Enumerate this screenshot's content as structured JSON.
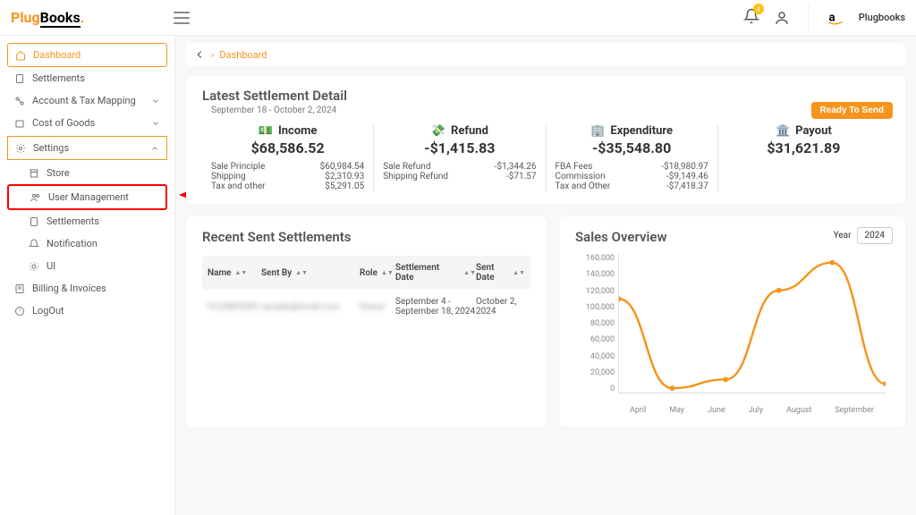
{
  "brand": {
    "plug": "Plug",
    "books": "Books"
  },
  "topbar": {
    "integration": "Plugbooks",
    "notif_count": "4"
  },
  "sidebar": {
    "dashboard": "Dashboard",
    "settlements": "Settlements",
    "account_tax": "Account & Tax Mapping",
    "cogs": "Cost of Goods",
    "settings": "Settings",
    "store": "Store",
    "user_mgmt": "User Management",
    "settlements2": "Settlements",
    "notification": "Notification",
    "ui": "UI",
    "billing": "Billing & Invoices",
    "logout": "LogOut"
  },
  "breadcrumb": {
    "current": "Dashboard"
  },
  "settlement": {
    "title": "Latest Settlement Detail",
    "range": "September 18 - October 2, 2024",
    "ready": "Ready To Send",
    "income": {
      "label": "Income",
      "value": "$68,586.52",
      "lines": [
        {
          "k": "Sale Principle",
          "v": "$60,984.54"
        },
        {
          "k": "Shipping",
          "v": "$2,310.93"
        },
        {
          "k": "Tax and other",
          "v": "$5,291.05"
        }
      ]
    },
    "refund": {
      "label": "Refund",
      "value": "-$1,415.83",
      "lines": [
        {
          "k": "Sale Refund",
          "v": "-$1,344.26"
        },
        {
          "k": "Shipping Refund",
          "v": "-$71.57"
        }
      ]
    },
    "expenditure": {
      "label": "Expenditure",
      "value": "-$35,548.80",
      "lines": [
        {
          "k": "FBA Fees",
          "v": "-$18,980.97"
        },
        {
          "k": "Commission",
          "v": "-$9,149.46"
        },
        {
          "k": "Tax and Other",
          "v": "-$7,418.37"
        }
      ]
    },
    "payout": {
      "label": "Payout",
      "value": "$31,621.89"
    }
  },
  "recent": {
    "title": "Recent Sent Settlements",
    "headers": {
      "name": "Name",
      "sent_by": "Sent By",
      "role": "Role",
      "sdate": "Settlement Date",
      "sentdate": "Sent Date"
    },
    "row": {
      "name": "PLUGBOOKS",
      "sent_by": "sample@email.com",
      "role": "Owner",
      "sdate": "September 4 - September 18, 2024",
      "sentdate": "October 2, 2024"
    }
  },
  "sales": {
    "title": "Sales Overview",
    "year_label": "Year",
    "year_value": "2024"
  },
  "chart_data": {
    "type": "line",
    "title": "Sales Overview",
    "xlabel": "",
    "ylabel": "",
    "ylim": [
      0,
      160000
    ],
    "y_ticks": [
      "160,000",
      "140,000",
      "120,000",
      "100,000",
      "80,000",
      "60,000",
      "40,000",
      "20,000",
      "0"
    ],
    "categories": [
      "April",
      "May",
      "June",
      "July",
      "August",
      "September"
    ],
    "values": [
      108000,
      5000,
      15000,
      118000,
      150000,
      10000
    ],
    "color": "#f7941d"
  }
}
